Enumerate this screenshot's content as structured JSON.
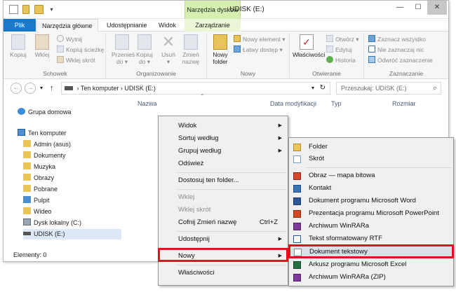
{
  "window": {
    "title": "UDISK (E:)",
    "tools_tab": "Narzędzia dysków",
    "minimize": "—",
    "maximize": "☐",
    "close": "✕"
  },
  "tabs": [
    {
      "label": "Plik"
    },
    {
      "label": "Narzędzia główne"
    },
    {
      "label": "Udostępnianie"
    },
    {
      "label": "Widok"
    },
    {
      "label": "Zarządzanie"
    }
  ],
  "ribbon": {
    "schowek": {
      "label": "Schowek",
      "kopiuj": "Kopiuj",
      "wklej": "Wklej",
      "wytnij": "Wytnij",
      "kopiuj_sciezke": "Kopiuj ścieżkę",
      "wklej_skrot": "Wklej skrót"
    },
    "organizowanie": {
      "label": "Organizowanie",
      "przenies_1": "Przenieś",
      "przenies_2": "do ▾",
      "kopiuj_1": "Kopiuj",
      "kopiuj_2": "do ▾",
      "usun_1": "Usuń",
      "usun_2": "▾",
      "zmien_1": "Zmień",
      "zmien_2": "nazwę"
    },
    "nowy": {
      "label": "Nowy",
      "folder_1": "Nowy",
      "folder_2": "folder",
      "nowy_element": "Nowy element ▾",
      "latwy_dostep": "Łatwy dostęp ▾"
    },
    "otwieranie": {
      "label": "Otwieranie",
      "wlasciwosci": "Właściwości",
      "otworz": "Otwórz ▾",
      "edytuj": "Edytuj",
      "historia": "Historia"
    },
    "zaznaczanie": {
      "label": "Zaznaczanie",
      "zaznacz_wszystko": "Zaznacz wszystko",
      "nie_zaznaczaj": "Nie zaznaczaj nic",
      "odwroc": "Odwróć zaznaczenie"
    }
  },
  "address": {
    "back": "←",
    "forward": "→",
    "recent": "▾",
    "up": "↑",
    "path_1": "Ten komputer",
    "sep": "›",
    "path_2": "UDISK (E:)",
    "dropdown": "▾",
    "refresh": "↻",
    "search_placeholder": "Przeszukaj: UDISK (E:)",
    "search_icon": "⌕"
  },
  "columns": {
    "name": "Nazwa",
    "date": "Data modyfikacji",
    "type": "Typ",
    "size": "Rozmiar",
    "sort_indicator": "⌃"
  },
  "nav": {
    "homegroup": "Grupa domowa",
    "computer": "Ten komputer",
    "items": [
      "Admin (asus)",
      "Dokumenty",
      "Muzyka",
      "Obrazy",
      "Pobrane",
      "Pulpit",
      "Wideo",
      "Dysk lokalny (C:)",
      "UDISK (E:)"
    ]
  },
  "status": {
    "elements": "Elementy: 0"
  },
  "context_menu": {
    "widok": "Widok",
    "sortuj": "Sortuj według",
    "grupuj": "Grupuj według",
    "odswiez": "Odśwież",
    "dostosuj": "Dostosuj ten folder...",
    "wklej": "Wklej",
    "wklej_skrot": "Wklej skrót",
    "cofnij": "Cofnij Zmień nazwę",
    "cofnij_shortcut": "Ctrl+Z",
    "udostepnij": "Udostępnij",
    "nowy": "Nowy",
    "wlasciwosci": "Właściwości",
    "arrow": "▶"
  },
  "submenu": {
    "items": [
      "Folder",
      "Skrót",
      "Obraz — mapa bitowa",
      "Kontakt",
      "Dokument programu Microsoft Word",
      "Prezentacja programu Microsoft PowerPoint",
      "Archiwum WinRARa",
      "Tekst sformatowany RTF",
      "Dokument tekstowy",
      "Arkusz programu Microsoft Excel",
      "Archiwum WinRARa (ZIP)"
    ]
  },
  "colors": {
    "accent_blue": "#1979ca",
    "tools_green": "#d6efb0",
    "highlight_red": "#e0121f",
    "menu_bg": "#f0f0f0"
  }
}
